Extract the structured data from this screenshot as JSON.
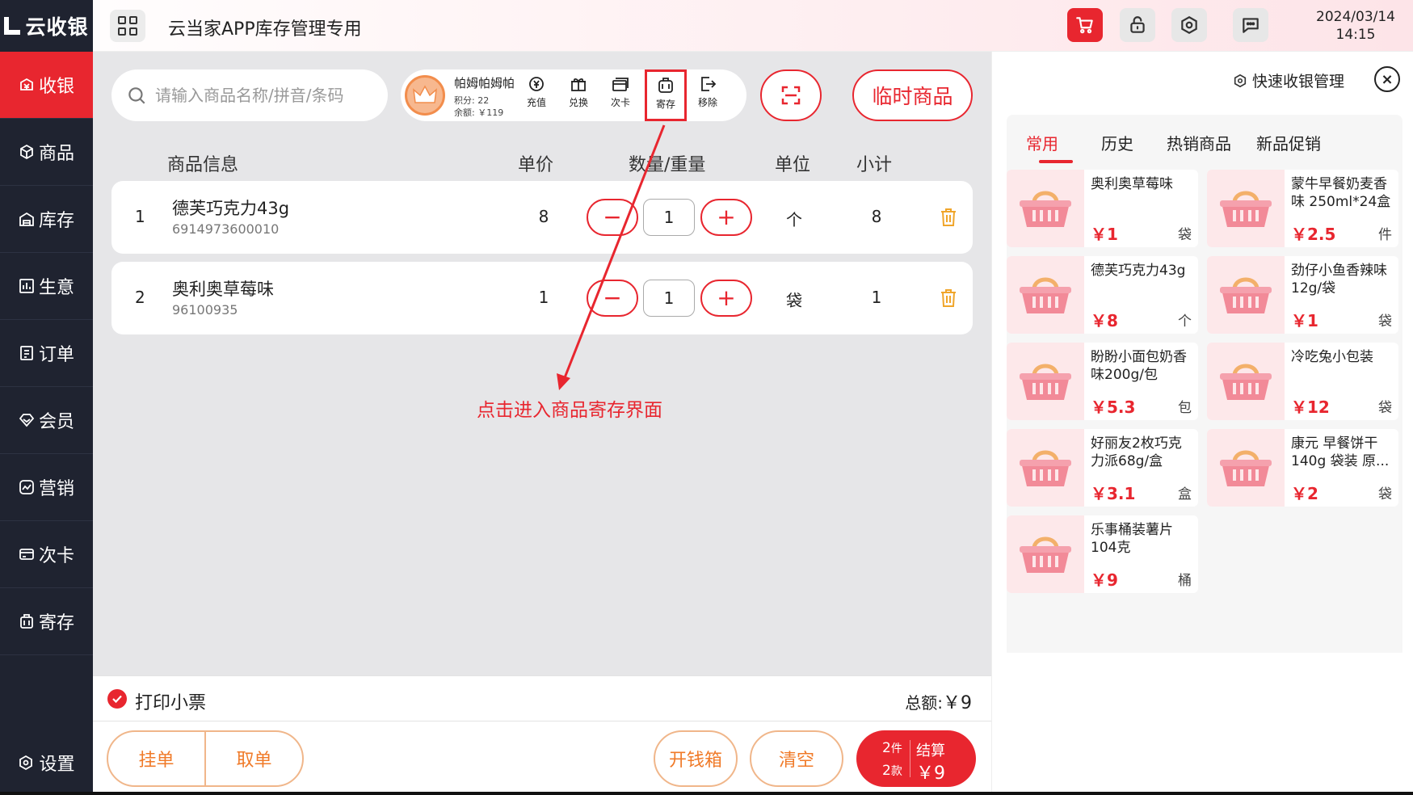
{
  "brand": {
    "logo_text": "云收银"
  },
  "header": {
    "title": "云当家APP库存管理专用",
    "date": "2024/03/14",
    "time": "14:15",
    "icons": [
      "cart-icon",
      "unlock-icon",
      "settings-icon",
      "message-icon"
    ]
  },
  "sidebar": {
    "items": [
      {
        "label": "收银",
        "icon": "cashier-icon",
        "active": true
      },
      {
        "label": "商品",
        "icon": "box-icon"
      },
      {
        "label": "库存",
        "icon": "warehouse-icon"
      },
      {
        "label": "生意",
        "icon": "chart-icon"
      },
      {
        "label": "订单",
        "icon": "order-icon"
      },
      {
        "label": "会员",
        "icon": "member-icon"
      },
      {
        "label": "营销",
        "icon": "marketing-icon"
      },
      {
        "label": "次卡",
        "icon": "card-icon"
      },
      {
        "label": "寄存",
        "icon": "storage-icon"
      }
    ],
    "settings_label": "设置"
  },
  "search": {
    "placeholder": "请输入商品名称/拼音/条码"
  },
  "member": {
    "name": "帕姆帕姆帕",
    "points": "积分: 22",
    "balance": "余额: ￥119",
    "actions": [
      {
        "label": "充值",
        "icon": "recharge-icon"
      },
      {
        "label": "兑换",
        "icon": "gift-icon"
      },
      {
        "label": "次卡",
        "icon": "cards-icon"
      },
      {
        "label": "寄存",
        "icon": "luggage-icon",
        "highlighted": true
      },
      {
        "label": "移除",
        "icon": "remove-icon"
      }
    ]
  },
  "temp_goods_label": "临时商品",
  "table": {
    "headers": {
      "info": "商品信息",
      "price": "单价",
      "qty": "数量/重量",
      "unit": "单位",
      "subtotal": "小计"
    },
    "rows": [
      {
        "idx": "1",
        "name": "德芙巧克力43g",
        "code": "6914973600010",
        "price": "8",
        "qty": "1",
        "unit": "个",
        "subtotal": "8"
      },
      {
        "idx": "2",
        "name": "奥利奥草莓味",
        "code": "96100935",
        "price": "1",
        "qty": "1",
        "unit": "袋",
        "subtotal": "1"
      }
    ]
  },
  "annotation": {
    "text": "点击进入商品寄存界面",
    "color": "#e8262f"
  },
  "print_receipt": {
    "label": "打印小票",
    "checked": true
  },
  "total_label": "总额:",
  "total_amount": "￥9",
  "footer": {
    "hold_label": "挂单",
    "retrieve_label": "取单",
    "cash_drawer_label": "开钱箱",
    "clear_label": "清空",
    "checkout": {
      "items_count": "2",
      "items_unit": "件",
      "kinds_count": "2",
      "kinds_unit": "款",
      "label": "结算",
      "amount": "￥9"
    }
  },
  "right_panel": {
    "quick_manage_label": "快速收银管理",
    "tabs": [
      {
        "label": "常用",
        "active": true
      },
      {
        "label": "历史"
      },
      {
        "label": "热销商品"
      },
      {
        "label": "新品促销"
      }
    ],
    "products": [
      {
        "name": "奥利奥草莓味",
        "price": "￥1",
        "unit": "袋"
      },
      {
        "name": "蒙牛早餐奶麦香味 250ml*24盒",
        "price": "￥2.5",
        "unit": "件"
      },
      {
        "name": "德芙巧克力43g",
        "price": "￥8",
        "unit": "个"
      },
      {
        "name": "劲仔小鱼香辣味12g/袋",
        "price": "￥1",
        "unit": "袋"
      },
      {
        "name": "盼盼小面包奶香味200g/包",
        "price": "￥5.3",
        "unit": "包"
      },
      {
        "name": "冷吃兔小包装",
        "price": "￥12",
        "unit": "袋"
      },
      {
        "name": "好丽友2枚巧克力派68g/盒",
        "price": "￥3.1",
        "unit": "盒"
      },
      {
        "name": "康元 早餐饼干140g 袋装 原...",
        "price": "￥2",
        "unit": "袋"
      },
      {
        "name": "乐事桶装薯片104克",
        "price": "￥9",
        "unit": "桶"
      }
    ]
  },
  "colors": {
    "accent": "#e8262f",
    "sidebar": "#1f2330",
    "orange": "#f07a28"
  }
}
